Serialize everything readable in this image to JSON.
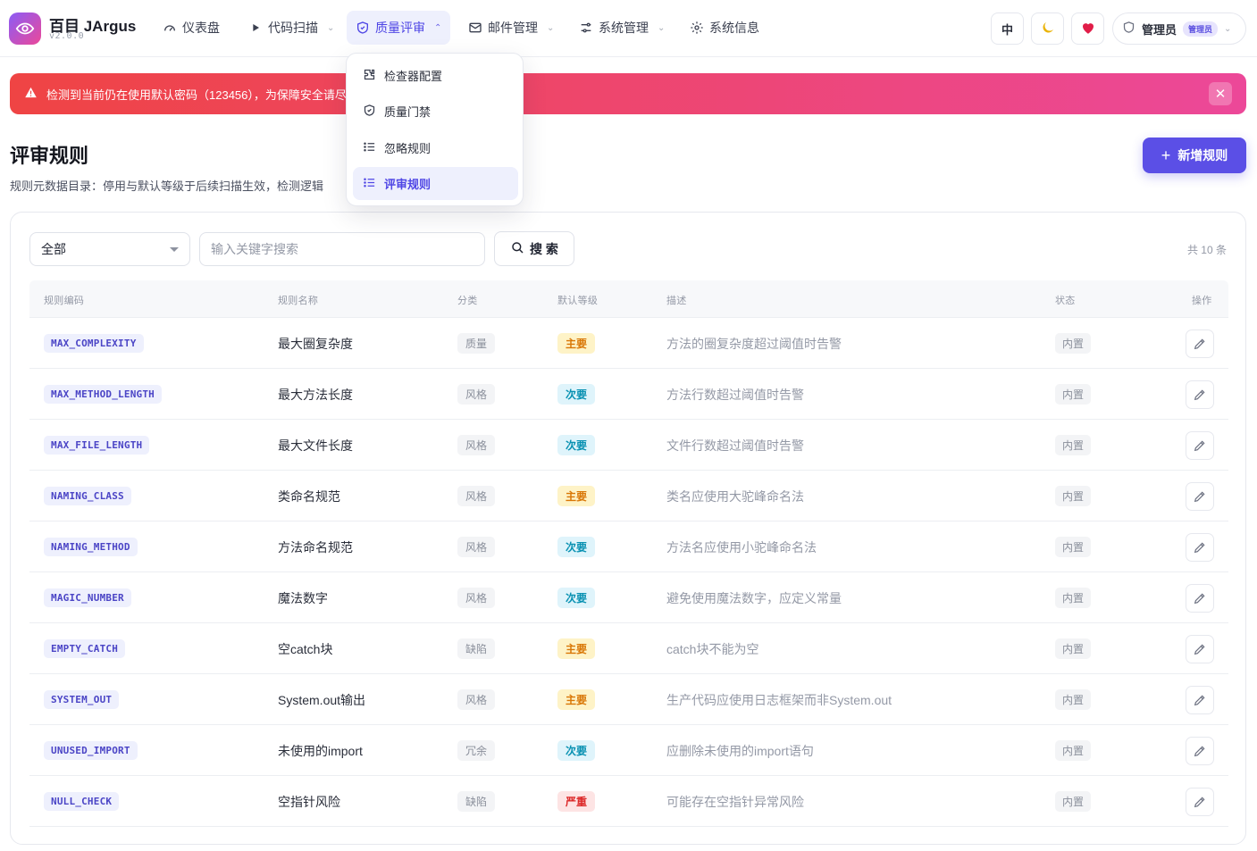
{
  "app": {
    "name": "百目 JArgus",
    "version": "v2.0.0"
  },
  "nav": {
    "items": [
      {
        "label": "仪表盘",
        "icon": "gauge-icon"
      },
      {
        "label": "代码扫描",
        "icon": "play-icon"
      },
      {
        "label": "质量评审",
        "icon": "shield-icon",
        "active": true
      },
      {
        "label": "邮件管理",
        "icon": "mail-icon"
      },
      {
        "label": "系统管理",
        "icon": "sliders-icon"
      },
      {
        "label": "系统信息",
        "icon": "gear-icon"
      }
    ],
    "lang_label": "中",
    "theme_icon": "moon-icon",
    "heart_icon": "heart-icon",
    "user_name": "管理员",
    "user_role": "管理员"
  },
  "dropdown": {
    "items": [
      {
        "label": "检查器配置",
        "icon": "puzzle-icon"
      },
      {
        "label": "质量门禁",
        "icon": "shield-icon"
      },
      {
        "label": "忽略规则",
        "icon": "list-icon"
      },
      {
        "label": "评审规则",
        "icon": "list-icon",
        "active": true
      }
    ]
  },
  "alert": {
    "text": "检测到当前仍在使用默认密码（123456），为保障安全请尽"
  },
  "page": {
    "title": "评审规则",
    "description": "规则元数据目录：停用与默认等级于后续扫描生效，检测逻辑",
    "add_button": "新增规则"
  },
  "filter": {
    "select_value": "全部",
    "search_placeholder": "输入关键字搜索",
    "search_button": "搜 索",
    "total": "共 10 条"
  },
  "table": {
    "headers": {
      "code": "规则编码",
      "name": "规则名称",
      "category": "分类",
      "level": "默认等级",
      "desc": "描述",
      "status": "状态",
      "action": "操作"
    },
    "rows": [
      {
        "code": "MAX_COMPLEXITY",
        "name": "最大圈复杂度",
        "category": "质量",
        "level": "主要",
        "level_type": "major",
        "desc": "方法的圈复杂度超过阈值时告警",
        "status": "内置"
      },
      {
        "code": "MAX_METHOD_LENGTH",
        "name": "最大方法长度",
        "category": "风格",
        "level": "次要",
        "level_type": "minor",
        "desc": "方法行数超过阈值时告警",
        "status": "内置"
      },
      {
        "code": "MAX_FILE_LENGTH",
        "name": "最大文件长度",
        "category": "风格",
        "level": "次要",
        "level_type": "minor",
        "desc": "文件行数超过阈值时告警",
        "status": "内置"
      },
      {
        "code": "NAMING_CLASS",
        "name": "类命名规范",
        "category": "风格",
        "level": "主要",
        "level_type": "major",
        "desc": "类名应使用大驼峰命名法",
        "status": "内置"
      },
      {
        "code": "NAMING_METHOD",
        "name": "方法命名规范",
        "category": "风格",
        "level": "次要",
        "level_type": "minor",
        "desc": "方法名应使用小驼峰命名法",
        "status": "内置"
      },
      {
        "code": "MAGIC_NUMBER",
        "name": "魔法数字",
        "category": "风格",
        "level": "次要",
        "level_type": "minor",
        "desc": "避免使用魔法数字，应定义常量",
        "status": "内置"
      },
      {
        "code": "EMPTY_CATCH",
        "name": "空catch块",
        "category": "缺陷",
        "level": "主要",
        "level_type": "major",
        "desc": "catch块不能为空",
        "status": "内置"
      },
      {
        "code": "SYSTEM_OUT",
        "name": "System.out输出",
        "category": "风格",
        "level": "主要",
        "level_type": "major",
        "desc": "生产代码应使用日志框架而非System.out",
        "status": "内置"
      },
      {
        "code": "UNUSED_IMPORT",
        "name": "未使用的import",
        "category": "冗余",
        "level": "次要",
        "level_type": "minor",
        "desc": "应删除未使用的import语句",
        "status": "内置"
      },
      {
        "code": "NULL_CHECK",
        "name": "空指针风险",
        "category": "缺陷",
        "level": "严重",
        "level_type": "crit",
        "desc": "可能存在空指针异常风险",
        "status": "内置"
      }
    ]
  }
}
